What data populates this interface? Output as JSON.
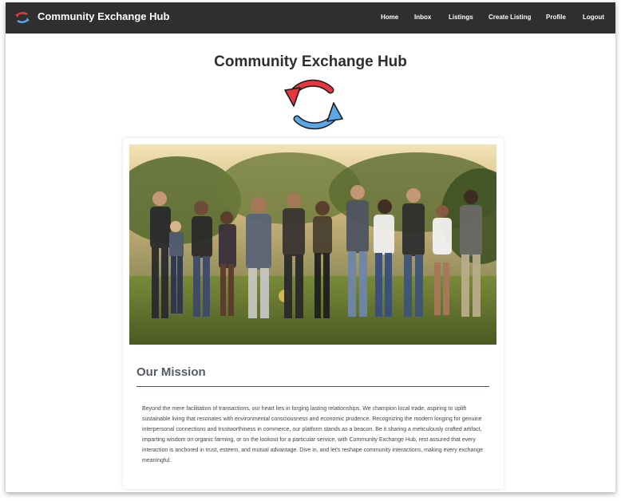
{
  "app": {
    "brand_title": "Community Exchange Hub",
    "brand_icon": "exchange-arrows-icon"
  },
  "nav": {
    "items": [
      {
        "label": "Home"
      },
      {
        "label": "Inbox"
      },
      {
        "label": "Listings"
      },
      {
        "label": "Create Listing"
      },
      {
        "label": "Profile"
      },
      {
        "label": "Logout"
      }
    ]
  },
  "main": {
    "title": "Community Exchange Hub",
    "hero_icon": "exchange-arrows-icon",
    "photo_icon": "community-group-photo",
    "mission": {
      "heading": "Our Mission",
      "body": "Beyond the mere facilitation of transactions, our heart lies in forging lasting relationships. We champion local trade, aspiring to uplift sustainable living that resonates with environmental consciousness and economic prudence. Recognizing the modern longing for genuine interpersonal connections and trustworthiness in commerce, our platform stands as a beacon. Be it sharing a meticulously crafted artifact, imparting wisdom on organic farming, or on the lookout for a particular service, with Community Exchange Hub, rest assured that every interaction is anchored in trust, esteem, and mutual advantage. Dive in, and let's reshape community interactions, making every exchange meaningful."
    }
  },
  "colors": {
    "navbar_bg": "#2f2f2f",
    "arrow_red": "#e8363f",
    "arrow_blue": "#5aa6e6",
    "heading": "#555a63"
  }
}
